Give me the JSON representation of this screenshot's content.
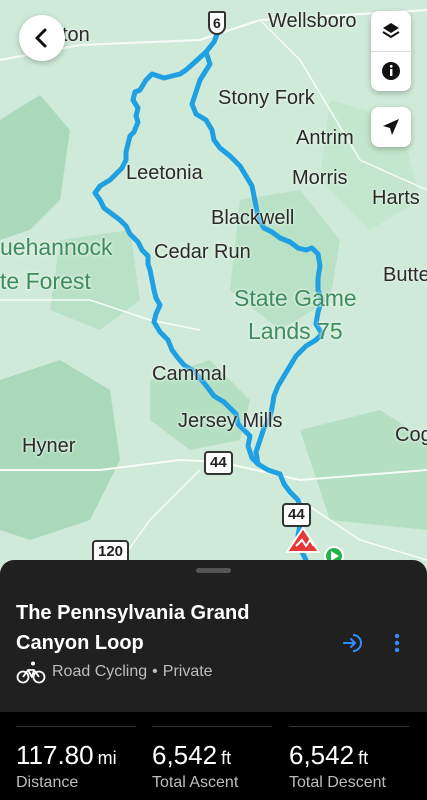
{
  "map": {
    "places": {
      "p1": "ton",
      "p2": "Wellsboro",
      "p3": "Stony Fork",
      "p4": "Antrim",
      "p5": "Morris",
      "p6": "Harts",
      "p7": "Leetonia",
      "p8": "Blackwell",
      "p9": "uehannock",
      "p10": "te Forest",
      "p11": "Cedar Run",
      "p12": "Butte",
      "p13": "State Game",
      "p14": "Lands 75",
      "p15": "Cammal",
      "p16": "Jersey Mills",
      "p17": "Cog",
      "p18": "Hyner"
    },
    "shields": {
      "us6": "6",
      "pa44a": "44",
      "pa44b": "44",
      "pa120": "120"
    },
    "route_color": "#1fa0e3"
  },
  "route": {
    "title": "The Pennsylvania Grand Canyon Loop",
    "activity": "Road Cycling",
    "visibility": "Private"
  },
  "stats": [
    {
      "value": "117.80",
      "unit": "mi",
      "label": "Distance"
    },
    {
      "value": "6,542",
      "unit": "ft",
      "label": "Total Ascent"
    },
    {
      "value": "6,542",
      "unit": "ft",
      "label": "Total Descent"
    }
  ],
  "icons": {
    "back": "back-chevron-icon",
    "layers": "layers-icon",
    "info": "info-icon",
    "locate": "locate-arrow-icon",
    "cycling": "bicycle-icon",
    "navigate": "navigate-icon",
    "more": "more-vertical-icon"
  },
  "colors": {
    "accent": "#2f8fff",
    "panel": "#202020",
    "start_marker": "#e53935",
    "end_marker": "#22b14c"
  }
}
